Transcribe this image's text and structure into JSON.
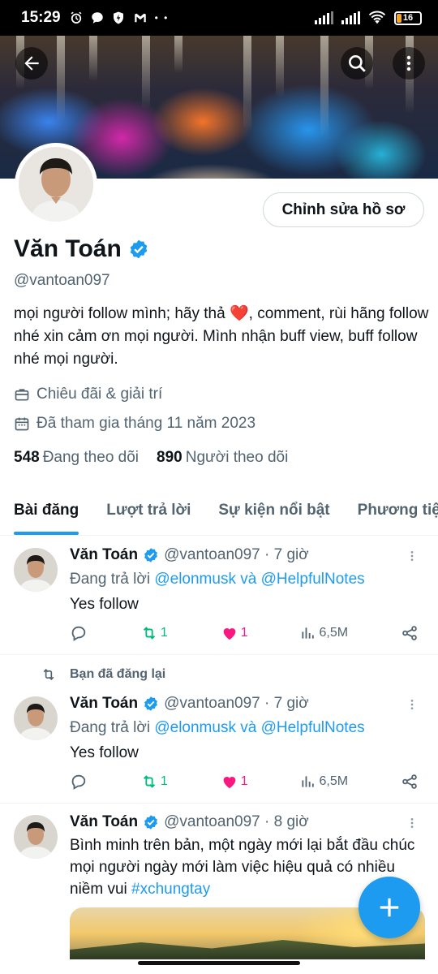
{
  "status_bar": {
    "time": "15:29",
    "battery": "16",
    "dots": "• •"
  },
  "colors": {
    "accent": "#1d9bf0",
    "retweet_green": "#00ba7c",
    "like_pink": "#f91880",
    "secondary_text": "#536471"
  },
  "profile": {
    "edit_button": "Chỉnh sửa hồ sơ",
    "name": "Văn Toán",
    "handle": "@vantoan097",
    "bio_before_emoji": "mọi người follow mình; hãy thả ",
    "bio_emoji": "❤️",
    "bio_after_emoji": ", comment, rùi hãng follow nhé xin cảm ơn mọi người. Mình nhận buff view, buff follow nhé mọi người.",
    "category": "Chiêu đãi & giải trí",
    "joined": "Đã tham gia tháng 11 năm 2023",
    "following_count": "548",
    "following_label": "Đang theo dõi",
    "followers_count": "890",
    "followers_label": "Người theo dõi"
  },
  "tabs": [
    {
      "label": "Bài đăng",
      "active": true
    },
    {
      "label": "Lượt trả lời",
      "active": false
    },
    {
      "label": "Sự kiện nổi bật",
      "active": false
    },
    {
      "label": "Phương tiện",
      "active": false
    }
  ],
  "tweets": [
    {
      "name": "Văn Toán",
      "handle_time": "@vantoan097 · 7 giờ",
      "reply_prefix": "Đang trả lời ",
      "reply_user1": "@elonmusk",
      "reply_and": " và ",
      "reply_user2": "@HelpfulNotes",
      "text": "Yes follow",
      "retweets": "1",
      "likes": "1",
      "views": "6,5M"
    },
    {
      "retweeted_label": "Bạn đã đăng lại",
      "name": "Văn Toán",
      "handle_time": "@vantoan097 · 7 giờ",
      "reply_prefix": "Đang trả lời ",
      "reply_user1": "@elonmusk",
      "reply_and": " và ",
      "reply_user2": "@HelpfulNotes",
      "text": "Yes follow",
      "retweets": "1",
      "likes": "1",
      "views": "6,5M"
    },
    {
      "name": "Văn Toán",
      "handle_time": "@vantoan097 · 8 giờ",
      "text": "Bình minh trên bản, một ngày mới lại bắt đầu chúc mọi người ngày mới làm việc hiệu quả có nhiều niềm vui ",
      "hashtag": "#xchungtay"
    }
  ]
}
